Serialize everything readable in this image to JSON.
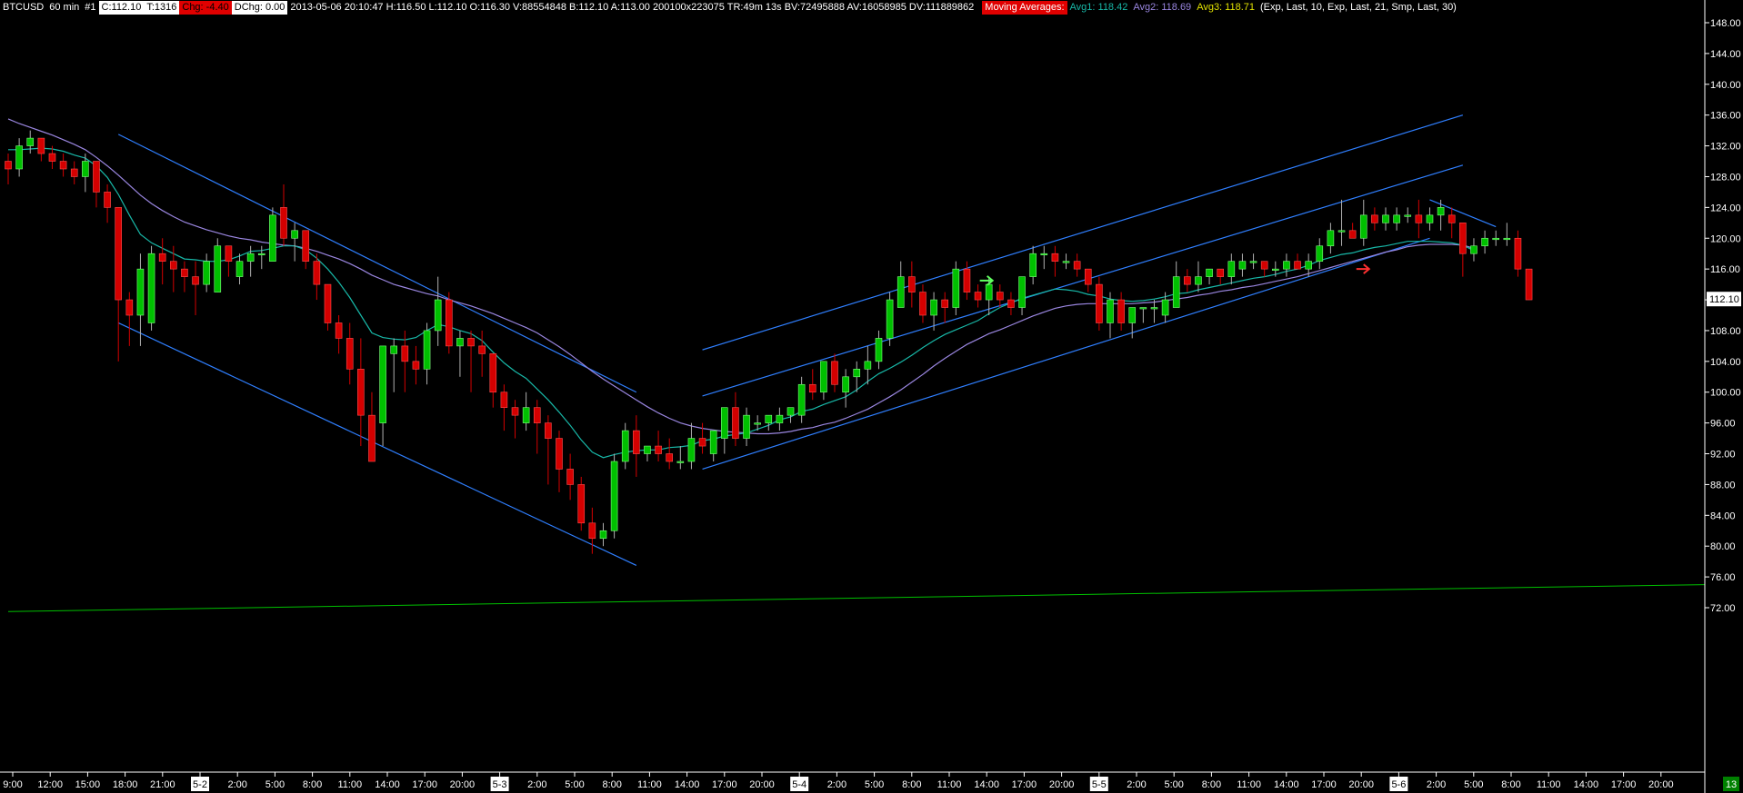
{
  "header": {
    "symbol": "BTCUSD",
    "interval": "60 min",
    "index": "#1",
    "close": "C:112.10",
    "ticks": "T:1316",
    "change": "Chg: -4.40",
    "dchange": "DChg: 0.00",
    "quote": "2013-05-06 20:10:47 H:116.50 L:112.10 O:116.30 V:88554848 B:112.10 A:113.00 200100x223075 TR:49m 13s BV:72495888 AV:16058985 DV:111889862",
    "ma_title": "Moving Averages:",
    "avg1": "Avg1: 118.42",
    "avg2": "Avg2: 118.69",
    "avg3": "Avg3: 118.71",
    "ma_params": "(Exp, Last, 10, Exp, Last, 21, Smp, Last, 30)"
  },
  "colors": {
    "background": "#000000",
    "up_candle": "#00c000",
    "down_candle": "#d40000",
    "wick": "#b0b0b0",
    "trendline": "#2f7fff",
    "avg1": "#18b8a8",
    "avg2": "#9a86e0",
    "support_line": "#00c000",
    "axis_text": "#ffffff",
    "last_price_bg": "#ffffff"
  },
  "chart_data": {
    "type": "candlestick",
    "ylim": [
      70,
      150
    ],
    "yticks": [
      "148.00",
      "144.00",
      "140.00",
      "136.00",
      "132.00",
      "128.00",
      "124.00",
      "120.00",
      "116.00",
      "112.00",
      "108.00",
      "104.00",
      "100.00",
      "96.00",
      "92.00",
      "88.00",
      "84.00",
      "80.00",
      "76.00",
      "72.00"
    ],
    "last_price_label": "112.10",
    "x_labels": [
      {
        "text": "9:00",
        "date": false
      },
      {
        "text": "12:00",
        "date": false
      },
      {
        "text": "15:00",
        "date": false
      },
      {
        "text": "18:00",
        "date": false
      },
      {
        "text": "21:00",
        "date": false
      },
      {
        "text": "5-2",
        "date": true
      },
      {
        "text": "2:00",
        "date": false
      },
      {
        "text": "5:00",
        "date": false
      },
      {
        "text": "8:00",
        "date": false
      },
      {
        "text": "11:00",
        "date": false
      },
      {
        "text": "14:00",
        "date": false
      },
      {
        "text": "17:00",
        "date": false
      },
      {
        "text": "20:00",
        "date": false
      },
      {
        "text": "5-3",
        "date": true
      },
      {
        "text": "2:00",
        "date": false
      },
      {
        "text": "5:00",
        "date": false
      },
      {
        "text": "8:00",
        "date": false
      },
      {
        "text": "11:00",
        "date": false
      },
      {
        "text": "14:00",
        "date": false
      },
      {
        "text": "17:00",
        "date": false
      },
      {
        "text": "20:00",
        "date": false
      },
      {
        "text": "5-4",
        "date": true
      },
      {
        "text": "2:00",
        "date": false
      },
      {
        "text": "5:00",
        "date": false
      },
      {
        "text": "8:00",
        "date": false
      },
      {
        "text": "11:00",
        "date": false
      },
      {
        "text": "14:00",
        "date": false
      },
      {
        "text": "17:00",
        "date": false
      },
      {
        "text": "20:00",
        "date": false
      },
      {
        "text": "5-5",
        "date": true
      },
      {
        "text": "2:00",
        "date": false
      },
      {
        "text": "5:00",
        "date": false
      },
      {
        "text": "8:00",
        "date": false
      },
      {
        "text": "11:00",
        "date": false
      },
      {
        "text": "14:00",
        "date": false
      },
      {
        "text": "17:00",
        "date": false
      },
      {
        "text": "20:00",
        "date": false
      },
      {
        "text": "5-6",
        "date": true
      },
      {
        "text": "2:00",
        "date": false
      },
      {
        "text": "5:00",
        "date": false
      },
      {
        "text": "8:00",
        "date": false
      },
      {
        "text": "11:00",
        "date": false
      },
      {
        "text": "14:00",
        "date": false
      },
      {
        "text": "17:00",
        "date": false
      },
      {
        "text": "20:00",
        "date": false
      }
    ],
    "page_number": "13",
    "candles": [
      [
        130,
        131,
        127,
        129
      ],
      [
        129,
        133,
        128,
        132
      ],
      [
        132,
        134,
        131,
        133
      ],
      [
        133,
        133,
        130,
        131
      ],
      [
        131,
        132,
        129,
        130
      ],
      [
        130,
        131,
        128,
        129
      ],
      [
        129,
        130,
        127,
        128
      ],
      [
        128,
        131,
        126,
        130
      ],
      [
        130,
        130,
        124,
        126
      ],
      [
        126,
        127,
        122,
        124
      ],
      [
        124,
        124,
        104,
        112
      ],
      [
        112,
        113,
        106,
        110
      ],
      [
        110,
        118,
        106,
        116
      ],
      [
        109,
        119,
        108,
        118
      ],
      [
        118,
        120,
        114,
        117
      ],
      [
        117,
        119,
        113,
        116
      ],
      [
        116,
        117,
        113,
        115
      ],
      [
        115,
        117,
        110,
        114
      ],
      [
        114,
        118,
        113,
        117
      ],
      [
        113,
        120,
        113,
        119
      ],
      [
        119,
        119,
        115,
        117
      ],
      [
        115,
        118,
        114,
        117
      ],
      [
        117,
        119,
        115,
        118
      ],
      [
        118,
        119,
        116,
        118
      ],
      [
        117,
        124,
        117,
        123
      ],
      [
        124,
        127,
        119,
        120
      ],
      [
        120,
        122,
        117,
        121
      ],
      [
        121,
        121,
        116,
        117
      ],
      [
        117,
        118,
        112,
        114
      ],
      [
        114,
        114,
        108,
        109
      ],
      [
        109,
        110,
        105,
        107
      ],
      [
        107,
        109,
        101,
        103
      ],
      [
        103,
        107,
        93,
        97
      ],
      [
        97,
        100,
        91,
        91
      ],
      [
        96,
        106,
        93,
        106
      ],
      [
        105,
        107,
        100,
        106
      ],
      [
        106,
        108,
        100,
        104
      ],
      [
        104,
        106,
        101,
        103
      ],
      [
        103,
        109,
        101,
        108
      ],
      [
        108,
        115,
        106,
        112
      ],
      [
        112,
        113,
        105,
        106
      ],
      [
        106,
        108,
        102,
        107
      ],
      [
        107,
        108,
        100,
        106
      ],
      [
        106,
        108,
        102,
        105
      ],
      [
        105,
        105,
        98,
        100
      ],
      [
        100,
        101,
        95,
        98
      ],
      [
        98,
        99,
        94,
        97
      ],
      [
        96,
        100,
        95,
        98
      ],
      [
        98,
        99,
        92,
        96
      ],
      [
        96,
        97,
        88,
        94
      ],
      [
        94,
        95,
        87,
        90
      ],
      [
        90,
        92,
        86,
        88
      ],
      [
        88,
        89,
        82,
        83
      ],
      [
        83,
        85,
        79,
        81
      ],
      [
        81,
        83,
        80,
        82
      ],
      [
        82,
        92,
        81,
        91
      ],
      [
        91,
        96,
        90,
        95
      ],
      [
        95,
        97,
        89,
        92
      ],
      [
        92,
        93,
        91,
        93
      ],
      [
        93,
        95,
        91,
        92
      ],
      [
        92,
        94,
        90,
        91
      ],
      [
        91,
        93,
        90,
        91
      ],
      [
        91,
        96,
        90,
        94
      ],
      [
        94,
        96,
        92,
        93
      ],
      [
        92,
        95,
        91,
        95
      ],
      [
        94,
        98,
        92,
        98
      ],
      [
        98,
        100,
        93,
        94
      ],
      [
        94,
        98,
        93,
        97
      ],
      [
        96,
        97,
        95,
        96
      ],
      [
        96,
        97,
        95,
        97
      ],
      [
        96,
        98,
        95,
        97
      ],
      [
        97,
        98,
        96,
        98
      ],
      [
        97,
        102,
        96,
        101
      ],
      [
        101,
        103,
        99,
        100
      ],
      [
        100,
        104,
        99,
        104
      ],
      [
        104,
        105,
        100,
        101
      ],
      [
        100,
        103,
        98,
        102
      ],
      [
        102,
        104,
        100,
        103
      ],
      [
        103,
        106,
        101,
        104
      ],
      [
        104,
        108,
        103,
        107
      ],
      [
        107,
        113,
        106,
        112
      ],
      [
        111,
        117,
        111,
        115
      ],
      [
        115,
        117,
        111,
        113
      ],
      [
        113,
        114,
        109,
        110
      ],
      [
        110,
        113,
        108,
        112
      ],
      [
        112,
        113,
        109,
        111
      ],
      [
        111,
        117,
        110,
        116
      ],
      [
        116,
        117,
        112,
        113
      ],
      [
        113,
        114,
        111,
        112
      ],
      [
        112,
        115,
        110,
        114
      ],
      [
        113,
        114,
        111,
        112
      ],
      [
        112,
        113,
        110,
        111
      ],
      [
        111,
        115,
        110,
        115
      ],
      [
        115,
        119,
        114,
        118
      ],
      [
        118,
        119,
        116,
        118
      ],
      [
        118,
        119,
        115,
        117
      ],
      [
        117,
        118,
        116,
        117
      ],
      [
        117,
        118,
        115,
        116
      ],
      [
        116,
        116,
        113,
        114
      ],
      [
        114,
        115,
        108,
        109
      ],
      [
        109,
        113,
        107,
        112
      ],
      [
        112,
        113,
        108,
        109
      ],
      [
        109,
        111,
        107,
        111
      ],
      [
        111,
        111,
        109,
        111
      ],
      [
        111,
        112,
        109,
        111
      ],
      [
        110,
        113,
        109,
        112
      ],
      [
        111,
        117,
        111,
        115
      ],
      [
        115,
        116,
        113,
        114
      ],
      [
        114,
        117,
        113,
        115
      ],
      [
        115,
        116,
        114,
        116
      ],
      [
        116,
        116,
        114,
        115
      ],
      [
        115,
        118,
        114,
        117
      ],
      [
        116,
        118,
        115,
        117
      ],
      [
        117,
        118,
        116,
        117
      ],
      [
        117,
        117,
        115,
        116
      ],
      [
        116,
        117,
        115,
        116
      ],
      [
        116,
        118,
        115,
        117
      ],
      [
        117,
        118,
        116,
        116
      ],
      [
        116,
        118,
        115,
        117
      ],
      [
        117,
        120,
        116,
        119
      ],
      [
        119,
        122,
        118,
        121
      ],
      [
        121,
        125,
        119,
        121
      ],
      [
        121,
        122,
        120,
        120
      ],
      [
        120,
        125,
        119,
        123
      ],
      [
        123,
        124,
        121,
        122
      ],
      [
        122,
        124,
        121,
        123
      ],
      [
        122,
        124,
        121,
        123
      ],
      [
        123,
        124,
        122,
        123
      ],
      [
        123,
        125,
        120,
        122
      ],
      [
        122,
        124,
        121,
        123
      ],
      [
        123,
        125,
        121,
        124
      ],
      [
        123,
        124,
        120,
        122
      ],
      [
        122,
        122,
        115,
        118
      ],
      [
        118,
        120,
        117,
        119
      ],
      [
        119,
        121,
        118,
        120
      ],
      [
        120,
        121,
        119,
        120
      ],
      [
        120,
        122,
        119,
        120
      ],
      [
        120,
        121,
        115,
        116
      ],
      [
        116,
        116,
        112,
        112
      ]
    ],
    "avg1": [
      131.5,
      131.5,
      131.6,
      131.7,
      131.6,
      131.3,
      130.8,
      130.4,
      129.4,
      127.9,
      125.7,
      123.0,
      120.5,
      119.4,
      118.7,
      118.0,
      117.3,
      117.2,
      117.0,
      117.0,
      117.2,
      117.7,
      118.3,
      118.4,
      118.7,
      119.0,
      119.0,
      118.5,
      117.4,
      116.0,
      114.3,
      112.3,
      110.0,
      107.7,
      107.1,
      106.9,
      106.8,
      107.1,
      108.0,
      108.8,
      108.5,
      108.0,
      107.6,
      106.7,
      105.2,
      103.8,
      102.7,
      101.8,
      100.4,
      99.0,
      97.4,
      95.7,
      93.8,
      92.2,
      91.5,
      91.9,
      92.2,
      92.4,
      92.5,
      92.5,
      92.8,
      92.9,
      93.1,
      93.7,
      93.9,
      94.3,
      94.5,
      94.7,
      95.2,
      95.7,
      96.4,
      96.8,
      97.5,
      97.8,
      98.4,
      98.9,
      99.4,
      100.3,
      101.4,
      102.4,
      103.1,
      103.9,
      104.8,
      105.8,
      106.7,
      107.5,
      108.1,
      108.7,
      109.3,
      110.2,
      111.0,
      111.6,
      112.2,
      112.6,
      113.0,
      113.4,
      113.3,
      113.1,
      112.7,
      112.5,
      112.1,
      111.9,
      111.8,
      111.9,
      112.1,
      112.4,
      112.8,
      112.9,
      113.3,
      113.6,
      113.9,
      114.2,
      114.5,
      114.8,
      115.0,
      115.3,
      115.7,
      116.0,
      116.5,
      117.1,
      117.5,
      117.9,
      118.1,
      118.5,
      118.8,
      119.0,
      119.3,
      119.6,
      119.6,
      119.6,
      119.5,
      119.4,
      119.1,
      118.4
    ],
    "avg2": [
      135.5,
      134.9,
      134.4,
      133.9,
      133.4,
      132.8,
      132.2,
      131.5,
      130.5,
      129.4,
      128.2,
      126.9,
      125.6,
      124.5,
      123.6,
      122.8,
      122.1,
      121.6,
      121.1,
      120.7,
      120.3,
      120.0,
      119.8,
      119.5,
      119.3,
      119.1,
      119.0,
      118.7,
      118.3,
      117.8,
      117.3,
      116.7,
      116.0,
      115.2,
      114.6,
      114.0,
      113.6,
      113.2,
      112.8,
      112.5,
      112.0,
      111.6,
      111.2,
      110.7,
      110.2,
      109.6,
      109.0,
      108.4,
      107.7,
      106.8,
      105.9,
      104.9,
      103.8,
      102.7,
      101.7,
      100.8,
      99.9,
      99.0,
      98.1,
      97.3,
      96.6,
      96.0,
      95.6,
      95.3,
      95.1,
      94.9,
      94.8,
      94.7,
      94.6,
      94.6,
      94.7,
      94.9,
      95.2,
      95.4,
      95.8,
      96.1,
      96.6,
      97.2,
      97.8,
      98.6,
      99.4,
      100.3,
      101.3,
      102.3,
      103.4,
      104.4,
      105.3,
      106.2,
      106.9,
      107.6,
      108.1,
      108.7,
      109.3,
      109.9,
      110.4,
      110.9,
      111.2,
      111.4,
      111.5,
      111.5,
      111.5,
      111.5,
      111.5,
      111.6,
      111.7,
      111.9,
      112.1,
      112.3,
      112.6,
      112.8,
      113.1,
      113.3,
      113.6,
      113.8,
      114.1,
      114.4,
      114.7,
      115.0,
      115.4,
      115.8,
      116.2,
      116.6,
      117.0,
      117.4,
      117.8,
      118.2,
      118.5,
      118.9,
      119.1,
      119.2,
      119.2,
      119.2,
      119.1,
      118.7
    ],
    "channels": [
      {
        "name": "",
        "points": [
          [
            10,
            133.5
          ],
          [
            57,
            100
          ]
        ]
      },
      {
        "name": "",
        "points": [
          [
            10,
            109
          ],
          [
            57,
            77.5
          ]
        ]
      },
      {
        "name": "",
        "points": [
          [
            63,
            105.5
          ],
          [
            132,
            136
          ]
        ]
      },
      {
        "name": "",
        "points": [
          [
            63,
            99.5
          ],
          [
            132,
            129.5
          ]
        ]
      },
      {
        "name": "",
        "points": [
          [
            63,
            90
          ],
          [
            129,
            120
          ]
        ]
      },
      {
        "name": "",
        "points": [
          [
            129,
            125
          ],
          [
            135,
            121.5
          ]
        ]
      }
    ],
    "support_line": [
      [
        0,
        71.5
      ],
      [
        138,
        75
      ]
    ]
  }
}
